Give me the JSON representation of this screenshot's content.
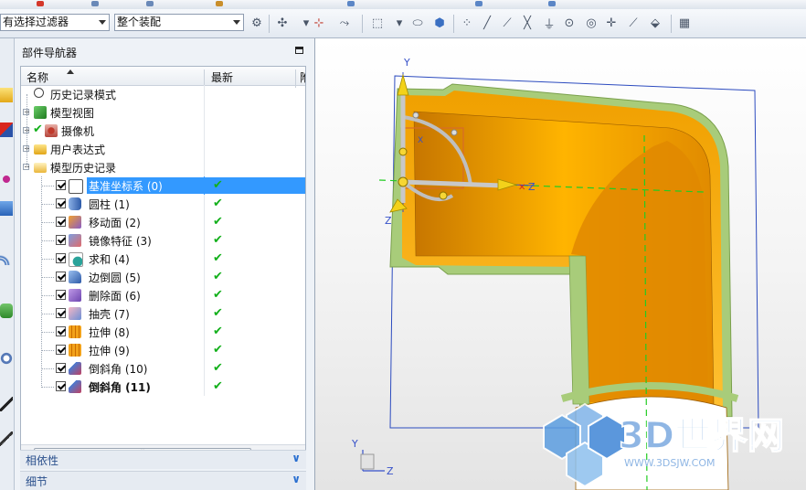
{
  "toolbar": {
    "filter_value": "有选择过滤器",
    "assembly_value": "整个装配"
  },
  "navigator": {
    "title": "部件导航器",
    "columns": {
      "name": "名称",
      "latest": "最新",
      "third": "附"
    },
    "top_nodes": [
      {
        "label": "历史记录模式"
      },
      {
        "label": "模型视图"
      },
      {
        "label": "摄像机"
      },
      {
        "label": "用户表达式"
      },
      {
        "label": "模型历史记录"
      }
    ],
    "features": [
      {
        "label": "基准坐标系 (0)",
        "latest": "✔"
      },
      {
        "label": "圆柱 (1)",
        "latest": "✔"
      },
      {
        "label": "移动面 (2)",
        "latest": "✔"
      },
      {
        "label": "镜像特征 (3)",
        "latest": "✔"
      },
      {
        "label": "求和 (4)",
        "latest": "✔"
      },
      {
        "label": "边倒圆 (5)",
        "latest": "✔"
      },
      {
        "label": "删除面 (6)",
        "latest": "✔"
      },
      {
        "label": "抽壳 (7)",
        "latest": "✔"
      },
      {
        "label": "拉伸 (8)",
        "latest": "✔"
      },
      {
        "label": "拉伸 (9)",
        "latest": "✔"
      },
      {
        "label": "倒斜角 (10)",
        "latest": "✔"
      },
      {
        "label": "倒斜角 (11)",
        "latest": "✔"
      }
    ],
    "panels": [
      {
        "label": "相依性"
      },
      {
        "label": "细节"
      }
    ]
  },
  "viewport": {
    "axis_labels": {
      "y": "Y",
      "x": "X",
      "z": "Z"
    },
    "triad_labels": {
      "y": "Y",
      "z": "Z"
    },
    "watermark": {
      "text": "3D世界网",
      "url": "WWW.3DSJW.COM"
    }
  },
  "colors": {
    "selection": "#3399ff",
    "part_face": "#f5a000",
    "part_edge": "#a8cc7a",
    "check": "#13b01b"
  }
}
